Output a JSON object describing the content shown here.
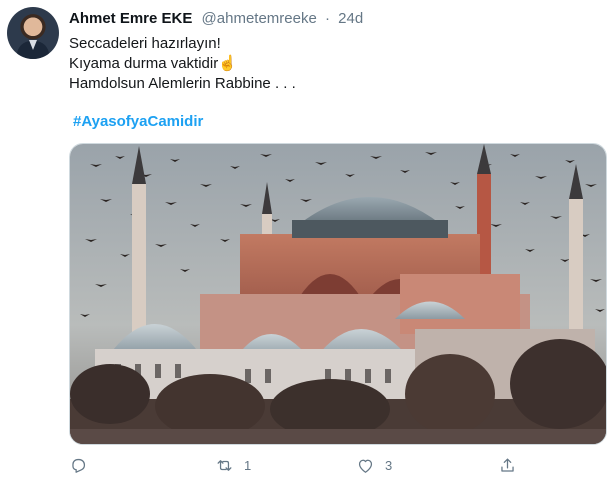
{
  "tweet": {
    "author_name": "Ahmet Emre EKE",
    "handle": "@ahmetemreeke",
    "separator": "·",
    "time": "24d",
    "lines": [
      "Seccadeleri hazırlayın!",
      "Kıyama durma vaktidir☝️",
      "Hamdolsun Alemlerin Rabbine . . ."
    ],
    "hashtag": "#AyasofyaCamidir",
    "media_icon": "hagia-sophia-photo",
    "actions": {
      "reply": {
        "icon": "reply-icon",
        "count": ""
      },
      "retweet": {
        "icon": "retweet-icon",
        "count": "1"
      },
      "like": {
        "icon": "like-icon",
        "count": "3"
      },
      "share": {
        "icon": "share-icon",
        "count": ""
      }
    }
  },
  "colors": {
    "accent": "#1da1f2",
    "muted": "#657786",
    "text": "#0f1419"
  }
}
